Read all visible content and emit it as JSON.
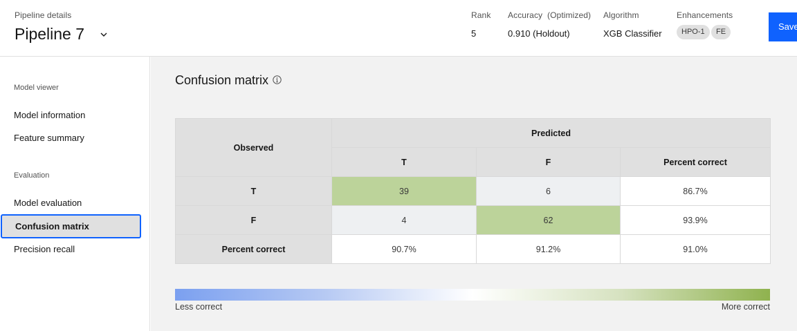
{
  "header": {
    "pipeline_details_label": "Pipeline details",
    "pipeline_title": "Pipeline 7",
    "rank_label": "Rank",
    "rank_value": "5",
    "accuracy_label": "Accuracy  (Optimized)",
    "accuracy_value": "0.910 (Holdout)",
    "algorithm_label": "Algorithm",
    "algorithm_value": "XGB Classifier",
    "enhancements_label": "Enhancements",
    "enhancement_tags": [
      "HPO-1",
      "FE"
    ],
    "save_label": "Save"
  },
  "sidebar": {
    "section_model_viewer": "Model viewer",
    "model_information": "Model information",
    "feature_summary": "Feature summary",
    "section_evaluation": "Evaluation",
    "model_evaluation": "Model evaluation",
    "confusion_matrix": "Confusion matrix",
    "precision_recall": "Precision recall"
  },
  "main": {
    "title": "Confusion matrix",
    "table": {
      "observed": "Observed",
      "predicted": "Predicted",
      "col_headers": [
        "T",
        "F",
        "Percent correct"
      ],
      "rows": [
        {
          "label": "T",
          "cells": [
            "39",
            "6",
            "86.7%"
          ]
        },
        {
          "label": "F",
          "cells": [
            "4",
            "62",
            "93.9%"
          ]
        },
        {
          "label": "Percent correct",
          "cells": [
            "90.7%",
            "91.2%",
            "91.0%"
          ]
        }
      ]
    },
    "legend": {
      "less": "Less correct",
      "more": "More correct"
    }
  },
  "colors": {
    "accent": "#0f62fe",
    "correct_cell": "#bcd39a",
    "incorrect_cell": "#eef0f2",
    "legend_low": "#7ba0f0",
    "legend_high": "#8fb24e"
  }
}
